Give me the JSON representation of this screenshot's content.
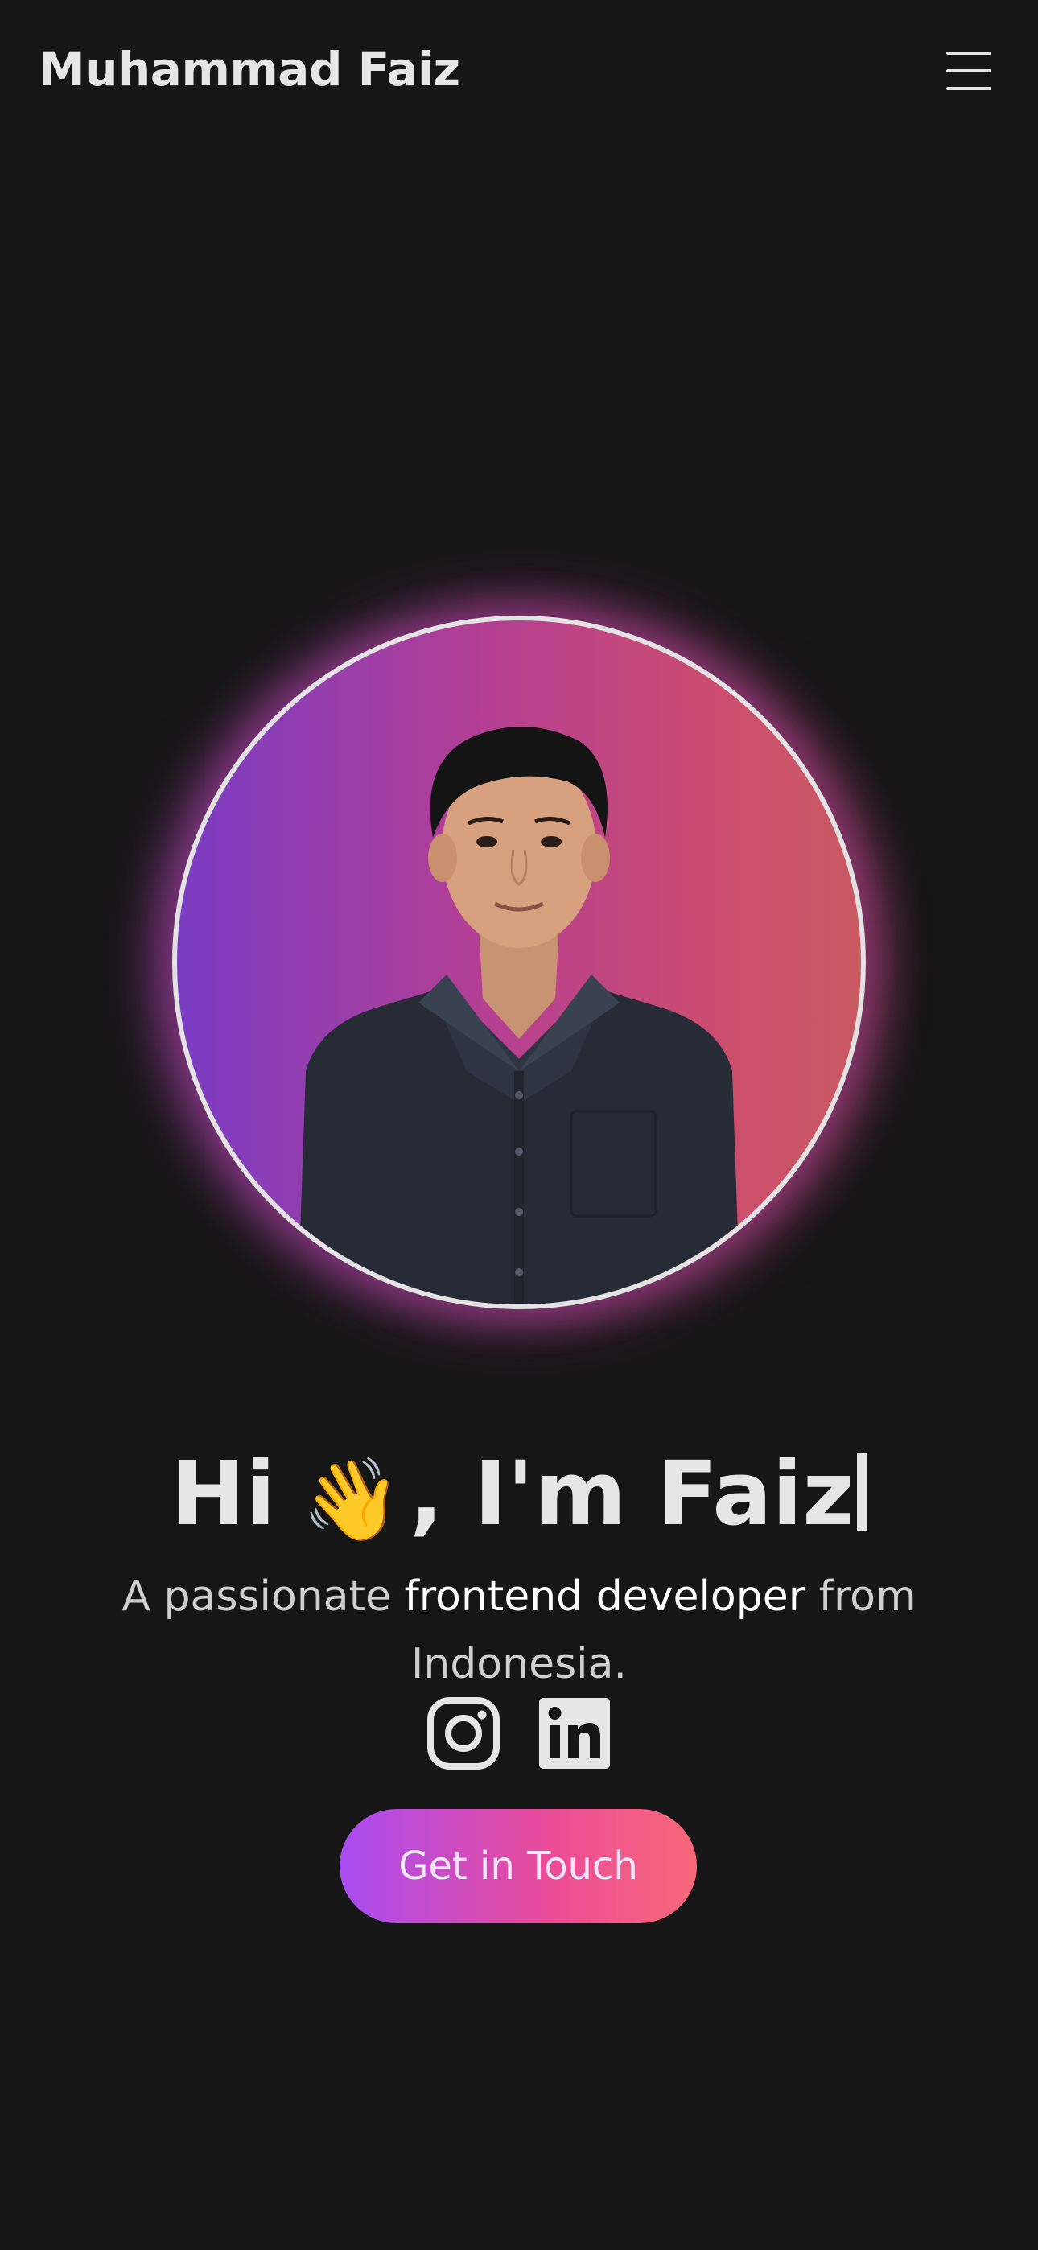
{
  "header": {
    "brand": "Muhammad Faiz",
    "menu_icon": "hamburger-menu-icon"
  },
  "hero": {
    "greeting_prefix": "Hi",
    "wave_emoji": "👋",
    "greeting_suffix": ", I'm Faiz",
    "tagline_part1": "A passionate ",
    "tagline_highlight": "frontend developer",
    "tagline_part2": " from Indonesia.",
    "avatar_alt": "Portrait photo",
    "socials": [
      {
        "icon": "instagram-icon"
      },
      {
        "icon": "linkedin-icon"
      }
    ],
    "cta_label": "Get in Touch"
  },
  "colors": {
    "background": "#161616",
    "text": "#e6e6e6",
    "cta_gradient_start": "#a84cf2",
    "cta_gradient_end": "#f8697a",
    "avatar_gradient_start": "#7a3cc4",
    "avatar_gradient_end": "#c95a62"
  }
}
